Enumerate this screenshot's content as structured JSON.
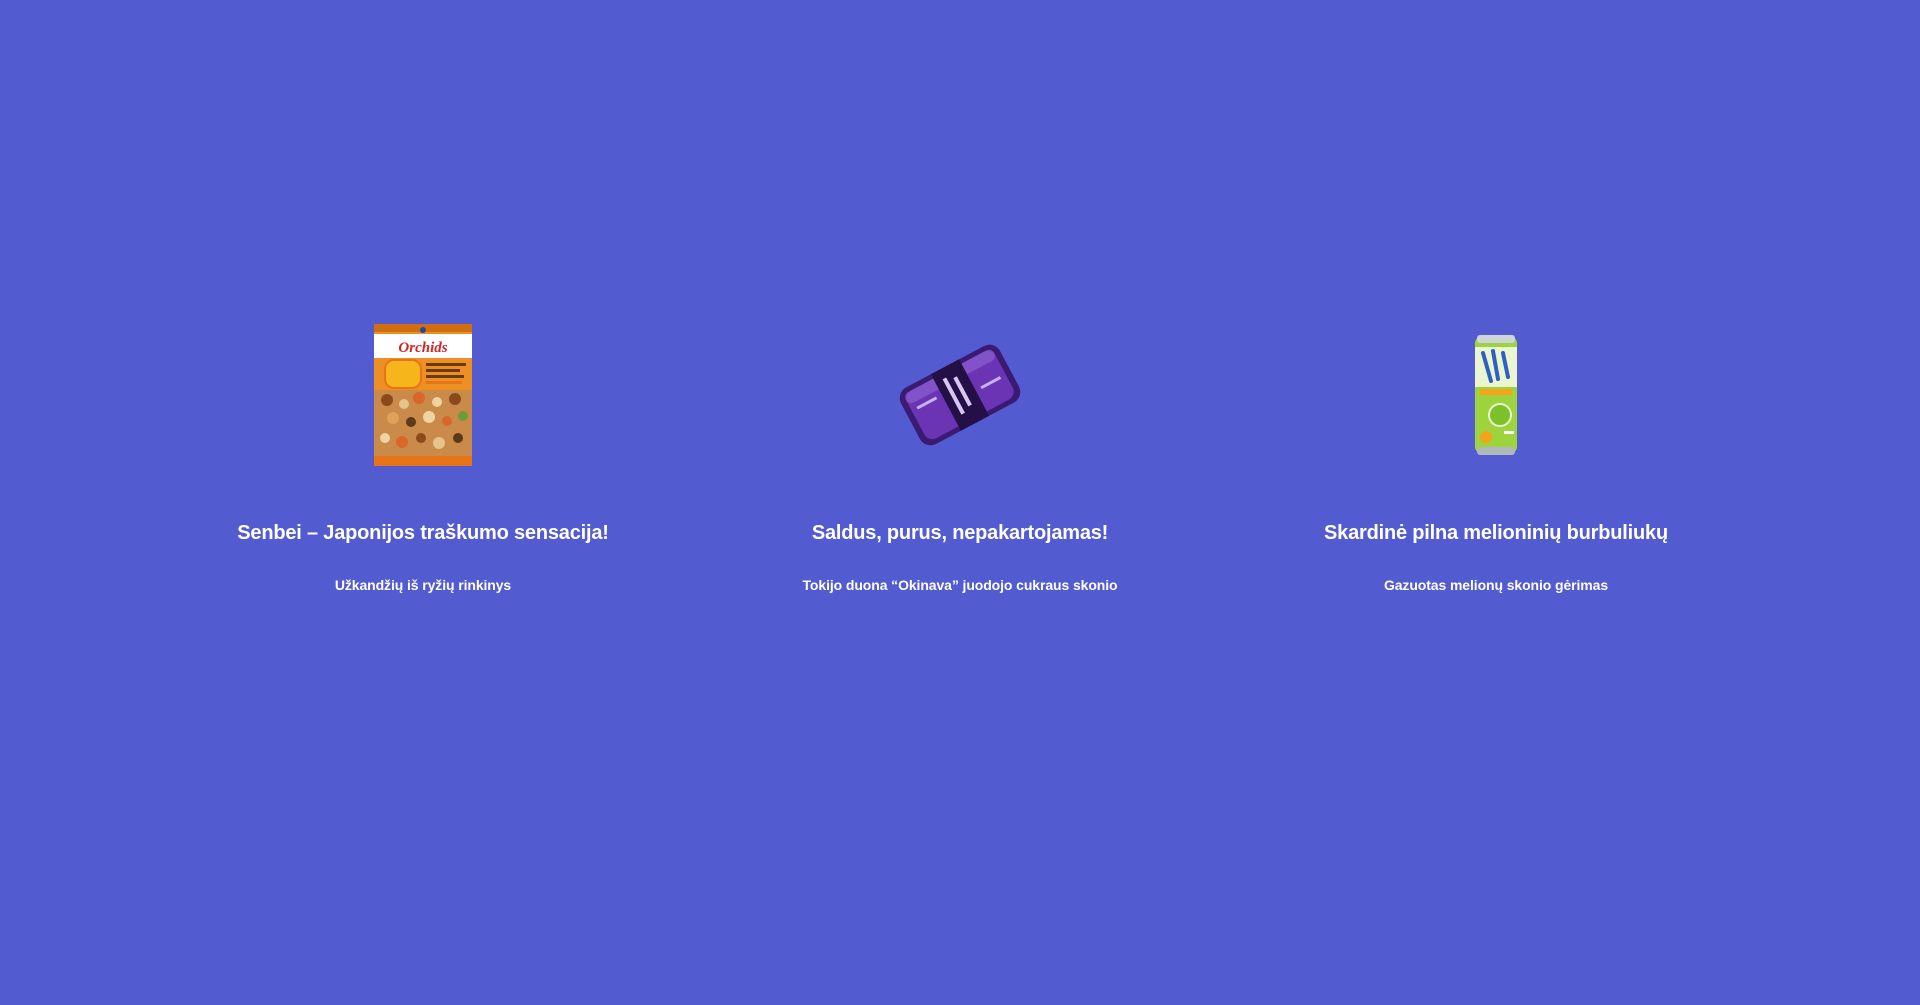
{
  "products": [
    {
      "title": "Senbei – Japonijos traškumo sensacija!",
      "subtitle": "Užkandžių iš ryžių rinkinys",
      "image_icon": "rice-cracker-bag",
      "image_text": "Orchids"
    },
    {
      "title": "Saldus, purus, nepakartojamas!",
      "subtitle": "Tokijo duona “Okinava” juodojo cukraus skonio",
      "image_icon": "sweet-bread-pack"
    },
    {
      "title": "Skardinė pilna melioninių burbuliukų",
      "subtitle": "Gazuotas melionų skonio gėrimas",
      "image_icon": "melon-soda-can"
    }
  ],
  "colors": {
    "background": "#525bd0",
    "text": "#ffffff"
  }
}
